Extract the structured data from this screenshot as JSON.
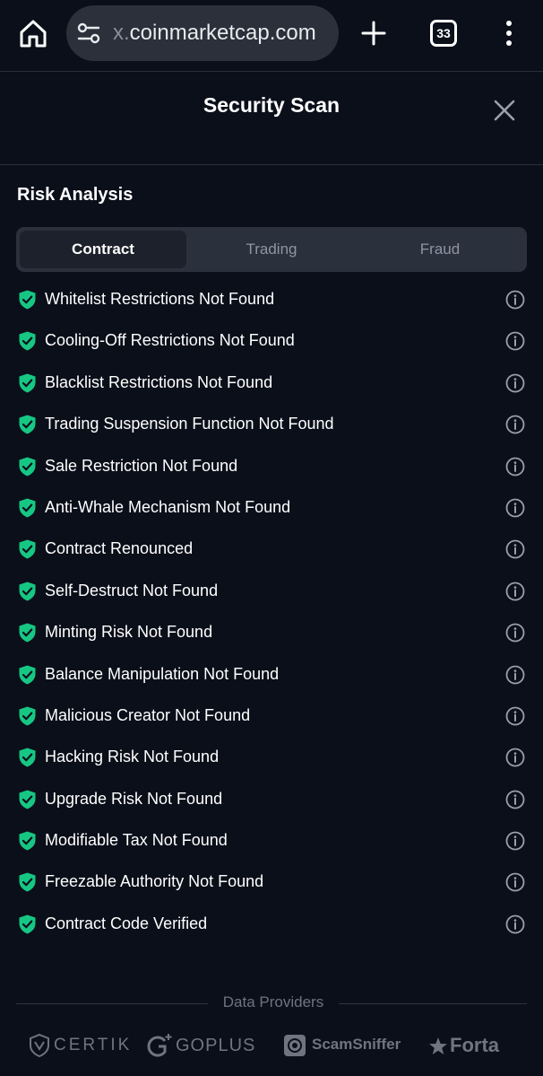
{
  "browser": {
    "url_prefix": "x.",
    "url_domain": "coinmarketcap.com",
    "tab_count": "33"
  },
  "modal": {
    "title": "Security Scan"
  },
  "section": {
    "title": "Risk Analysis"
  },
  "tabs": [
    {
      "label": "Contract",
      "active": true
    },
    {
      "label": "Trading",
      "active": false
    },
    {
      "label": "Fraud",
      "active": false
    }
  ],
  "risk_items": [
    {
      "label": "Whitelist Restrictions Not Found",
      "status": "safe"
    },
    {
      "label": "Cooling-Off Restrictions Not Found",
      "status": "safe"
    },
    {
      "label": "Blacklist Restrictions Not Found",
      "status": "safe"
    },
    {
      "label": "Trading Suspension Function Not Found",
      "status": "safe"
    },
    {
      "label": "Sale Restriction Not Found",
      "status": "safe"
    },
    {
      "label": "Anti-Whale Mechanism Not Found",
      "status": "safe"
    },
    {
      "label": "Contract Renounced",
      "status": "safe"
    },
    {
      "label": "Self-Destruct Not Found",
      "status": "safe"
    },
    {
      "label": "Minting Risk Not Found",
      "status": "safe"
    },
    {
      "label": "Balance Manipulation Not Found",
      "status": "safe"
    },
    {
      "label": "Malicious Creator Not Found",
      "status": "safe"
    },
    {
      "label": "Hacking Risk Not Found",
      "status": "safe"
    },
    {
      "label": "Upgrade Risk Not Found",
      "status": "safe"
    },
    {
      "label": "Modifiable Tax Not Found",
      "status": "safe"
    },
    {
      "label": "Freezable Authority Not Found",
      "status": "safe"
    },
    {
      "label": "Contract Code Verified",
      "status": "safe"
    }
  ],
  "providers": {
    "title": "Data Providers",
    "logos": [
      {
        "name": "CERTIK",
        "icon": "certik-shield-icon"
      },
      {
        "name": "GOPLUS",
        "icon": "goplus-icon"
      },
      {
        "name": "ScamSniffer",
        "icon": "scamsniffer-icon"
      },
      {
        "name": "Forta",
        "icon": "forta-star-icon"
      }
    ]
  },
  "colors": {
    "background": "#0b0f1a",
    "safe": "#16c784",
    "tab_track": "#2b303d",
    "tab_active": "#1d212b",
    "muted_text": "#8f95a3"
  }
}
